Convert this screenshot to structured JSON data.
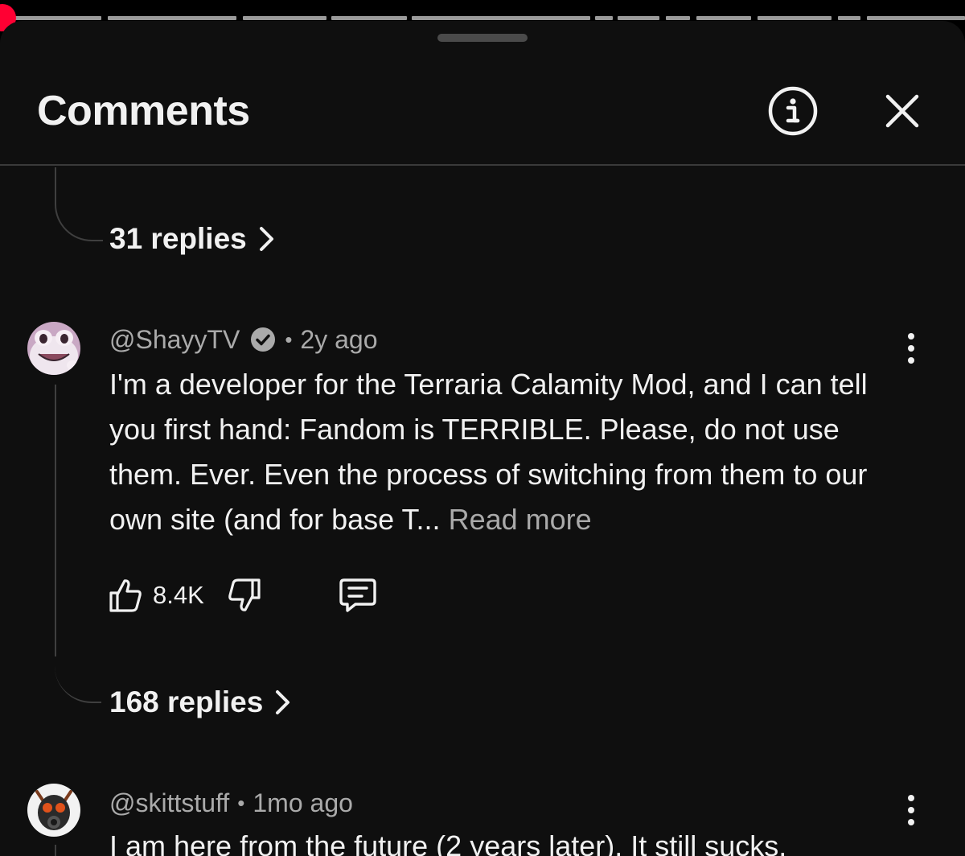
{
  "header": {
    "title": "Comments",
    "info_icon": "info-icon",
    "close_icon": "close-icon"
  },
  "colors": {
    "background": "#0f0f0f",
    "text_primary": "#f1f1f1",
    "text_secondary": "#aaaaaa",
    "scrubber": "#ff0033"
  },
  "thread_top": {
    "replies_label": "31 replies"
  },
  "comments": [
    {
      "author": "@ShayyTV",
      "verified": true,
      "separator": "•",
      "time": "2y ago",
      "text": "I'm a developer for the Terraria Calamity Mod, and I can tell you first hand: Fandom is TERRIBLE. Please, do not use them. Ever. Even the process of switching from them to our own site (and for base T...",
      "read_more": "Read more",
      "likes": "8.4K",
      "replies_label": "168 replies"
    },
    {
      "author": "@skittstuff",
      "separator": "•",
      "time": "1mo ago",
      "text": "I am here from the future (2 years later). It still sucks."
    }
  ]
}
